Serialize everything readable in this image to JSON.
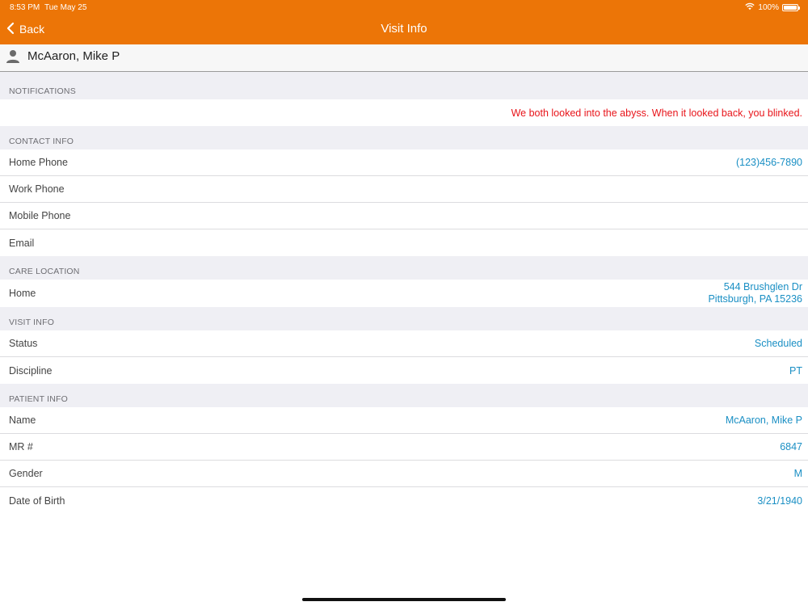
{
  "status_bar": {
    "time": "8:53 PM",
    "date": "Tue May 25",
    "battery": "100%"
  },
  "nav": {
    "back_label": "Back",
    "title": "Visit Info"
  },
  "patient": {
    "name": "McAaron, Mike P"
  },
  "sections": {
    "notifications": {
      "header": "NOTIFICATIONS",
      "message": "We both looked into the abyss.  When it looked back, you blinked."
    },
    "contact_info": {
      "header": "CONTACT INFO",
      "rows": [
        {
          "label": "Home Phone",
          "value": "(123)456-7890"
        },
        {
          "label": "Work Phone",
          "value": ""
        },
        {
          "label": "Mobile Phone",
          "value": ""
        },
        {
          "label": "Email",
          "value": ""
        }
      ]
    },
    "care_location": {
      "header": "CARE LOCATION",
      "label": "Home",
      "address_line1": "544 Brushglen Dr",
      "address_line2": "Pittsburgh, PA 15236"
    },
    "visit_info": {
      "header": "VISIT INFO",
      "rows": [
        {
          "label": "Status",
          "value": "Scheduled"
        },
        {
          "label": "Discipline",
          "value": "PT"
        }
      ]
    },
    "patient_info": {
      "header": "PATIENT INFO",
      "rows": [
        {
          "label": "Name",
          "value": "McAaron, Mike P"
        },
        {
          "label": "MR #",
          "value": "6847"
        },
        {
          "label": "Gender",
          "value": "M"
        },
        {
          "label": "Date of Birth",
          "value": "3/21/1940"
        }
      ]
    }
  },
  "colors": {
    "header_bg": "#ec7507",
    "value_blue": "#1a8fc4",
    "notification_red": "#e8141a",
    "section_bg": "#efeff4"
  },
  "icons": {
    "back": "chevron-left-icon",
    "patient": "person-icon",
    "wifi": "wifi-icon",
    "battery": "battery-icon"
  }
}
